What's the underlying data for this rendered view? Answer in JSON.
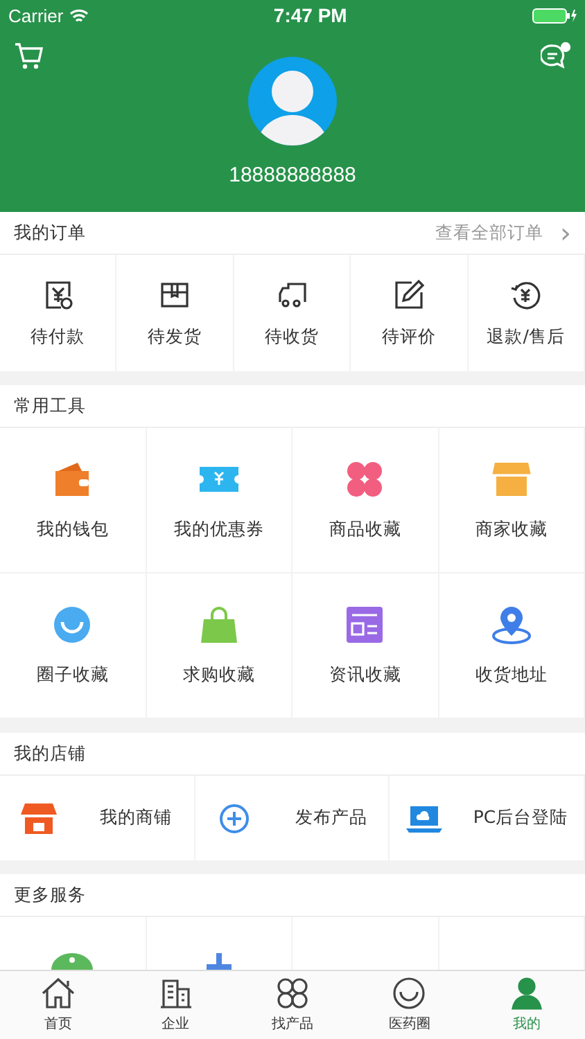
{
  "status_bar": {
    "carrier": "Carrier",
    "time": "7:47 PM"
  },
  "profile": {
    "phone": "18888888888",
    "has_unread": true
  },
  "orders": {
    "title": "我的订单",
    "link": "查看全部订单",
    "link_arrow": "›",
    "items": [
      "待付款",
      "待发货",
      "待收货",
      "待评价",
      "退款/售后"
    ]
  },
  "tools": {
    "title": "常用工具",
    "items": [
      "我的钱包",
      "我的优惠券",
      "商品收藏",
      "商家收藏",
      "圈子收藏",
      "求购收藏",
      "资讯收藏",
      "收货地址"
    ]
  },
  "shop": {
    "title": "我的店铺",
    "items": [
      "我的商铺",
      "发布产品",
      "PC后台登陆"
    ]
  },
  "more": {
    "title": "更多服务"
  },
  "tab_bar": [
    {
      "label": "首页",
      "selected": false
    },
    {
      "label": "企业",
      "selected": false
    },
    {
      "label": "找产品",
      "selected": false
    },
    {
      "label": "医药圈",
      "selected": false
    },
    {
      "label": "我的",
      "selected": true
    }
  ]
}
